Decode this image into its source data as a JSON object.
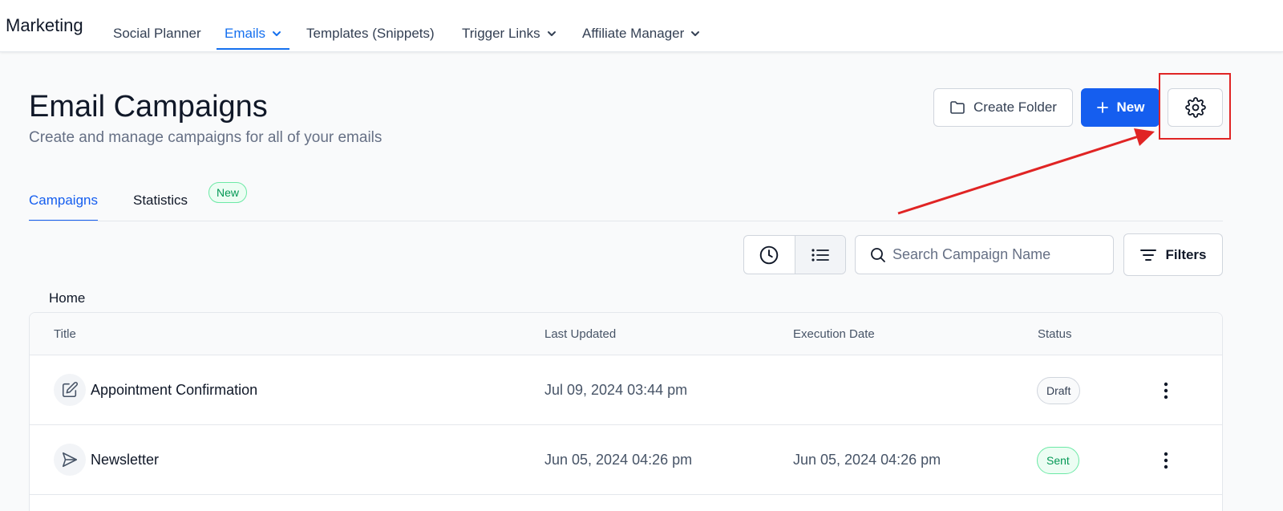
{
  "app": {
    "brand": "Marketing"
  },
  "nav": {
    "items": [
      {
        "label": "Social Planner"
      },
      {
        "label": "Emails"
      },
      {
        "label": "Templates (Snippets)"
      },
      {
        "label": "Trigger Links"
      },
      {
        "label": "Affiliate Manager"
      }
    ]
  },
  "header": {
    "title": "Email Campaigns",
    "subtitle": "Create and manage campaigns for all of your emails",
    "create_folder_label": "Create Folder",
    "new_label": "New"
  },
  "tabs": {
    "campaigns": "Campaigns",
    "statistics": "Statistics",
    "new_badge": "New"
  },
  "toolbar": {
    "search_placeholder": "Search Campaign Name",
    "filters_label": "Filters"
  },
  "breadcrumb": "Home",
  "table": {
    "columns": [
      "Title",
      "Last Updated",
      "Execution Date",
      "Status"
    ],
    "rows": [
      {
        "icon": "edit-icon",
        "title": "Appointment Confirmation",
        "last_updated": "Jul 09, 2024 03:44 pm",
        "execution_date": "",
        "status": "Draft"
      },
      {
        "icon": "send-icon",
        "title": "Newsletter",
        "last_updated": "Jun 05, 2024 04:26 pm",
        "execution_date": "Jun 05, 2024 04:26 pm",
        "status": "Sent"
      }
    ]
  },
  "colors": {
    "accent": "#155eef",
    "annotation": "#e02424",
    "sent": "#039855"
  }
}
